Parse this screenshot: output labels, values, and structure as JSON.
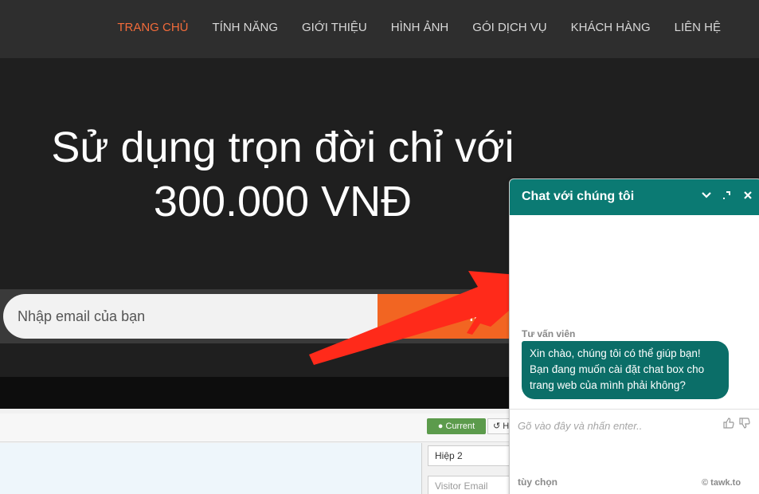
{
  "nav": {
    "items": [
      {
        "label": "TRANG CHỦ",
        "active": true
      },
      {
        "label": "TÍNH NĂNG",
        "active": false
      },
      {
        "label": "GIỚI THIỆU",
        "active": false
      },
      {
        "label": "HÌNH ẢNH",
        "active": false
      },
      {
        "label": "GÓI DỊCH VỤ",
        "active": false
      },
      {
        "label": "KHÁCH HÀNG",
        "active": false
      },
      {
        "label": "LIÊN HỆ",
        "active": false
      }
    ]
  },
  "hero": {
    "title_line1": "Sử dụng trọn đời chỉ với",
    "title_line2": "300.000 VNĐ",
    "email_placeholder": "Nhập email của bạn",
    "button_label": "Đ         N"
  },
  "preview": {
    "tab_current": "Current",
    "tab_history": "H",
    "field_hiep": "Hiệp 2",
    "field_visitor_email": "Visitor Email"
  },
  "chat": {
    "title": "Chat với chúng tôi",
    "agent_name": "Tư vấn viên",
    "message_lines": [
      "Xin chào, chúng tôi có thể giúp bạn!",
      "Bạn đang muốn cài đặt chat box cho",
      "trang web của mình phải không?"
    ],
    "input_placeholder": "Gõ vào đây và nhấn enter..",
    "options_label": "tùy chọn",
    "brand": "© tawk.to"
  },
  "colors": {
    "accent_orange": "#f26522",
    "nav_active": "#f26b3a",
    "chat_teal": "#0b7a73",
    "arrow_red": "#ff2a1a"
  }
}
